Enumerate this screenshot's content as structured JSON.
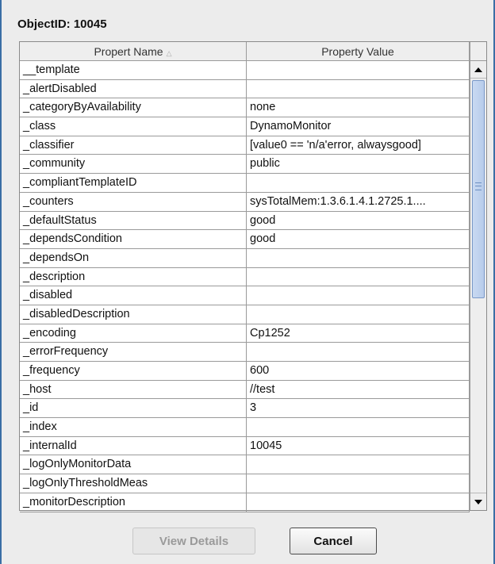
{
  "dialog": {
    "title": "ObjectID: 10045"
  },
  "table": {
    "columns": [
      "Propert Name",
      "Property Value"
    ],
    "sort_indicator": "△",
    "rows": [
      [
        "__template",
        ""
      ],
      [
        "_alertDisabled",
        ""
      ],
      [
        "_categoryByAvailability",
        "none"
      ],
      [
        "_class",
        "DynamoMonitor"
      ],
      [
        "_classifier",
        "[value0 == 'n/a'error, alwaysgood]"
      ],
      [
        "_community",
        "public"
      ],
      [
        "_compliantTemplateID",
        ""
      ],
      [
        "_counters",
        "sysTotalMem:1.3.6.1.4.1.2725.1...."
      ],
      [
        "_defaultStatus",
        "good"
      ],
      [
        "_dependsCondition",
        "good"
      ],
      [
        "_dependsOn",
        ""
      ],
      [
        "_description",
        ""
      ],
      [
        "_disabled",
        ""
      ],
      [
        "_disabledDescription",
        ""
      ],
      [
        "_encoding",
        "Cp1252"
      ],
      [
        "_errorFrequency",
        ""
      ],
      [
        "_frequency",
        "600"
      ],
      [
        "_host",
        "//test"
      ],
      [
        "_id",
        "3"
      ],
      [
        "_index",
        ""
      ],
      [
        "_internalId",
        "10045"
      ],
      [
        "_logOnlyMonitorData",
        ""
      ],
      [
        "_logOnlyThresholdMeas",
        ""
      ],
      [
        "_monitorDescription",
        ""
      ]
    ]
  },
  "scrollbar": {
    "up_icon": "arrow-up-icon",
    "down_icon": "arrow-down-icon"
  },
  "buttons": {
    "view_details": "View Details",
    "cancel": "Cancel"
  },
  "colors": {
    "window_border": "#3a6ea5",
    "background": "#ececec",
    "thumb": "#c9daf2"
  }
}
